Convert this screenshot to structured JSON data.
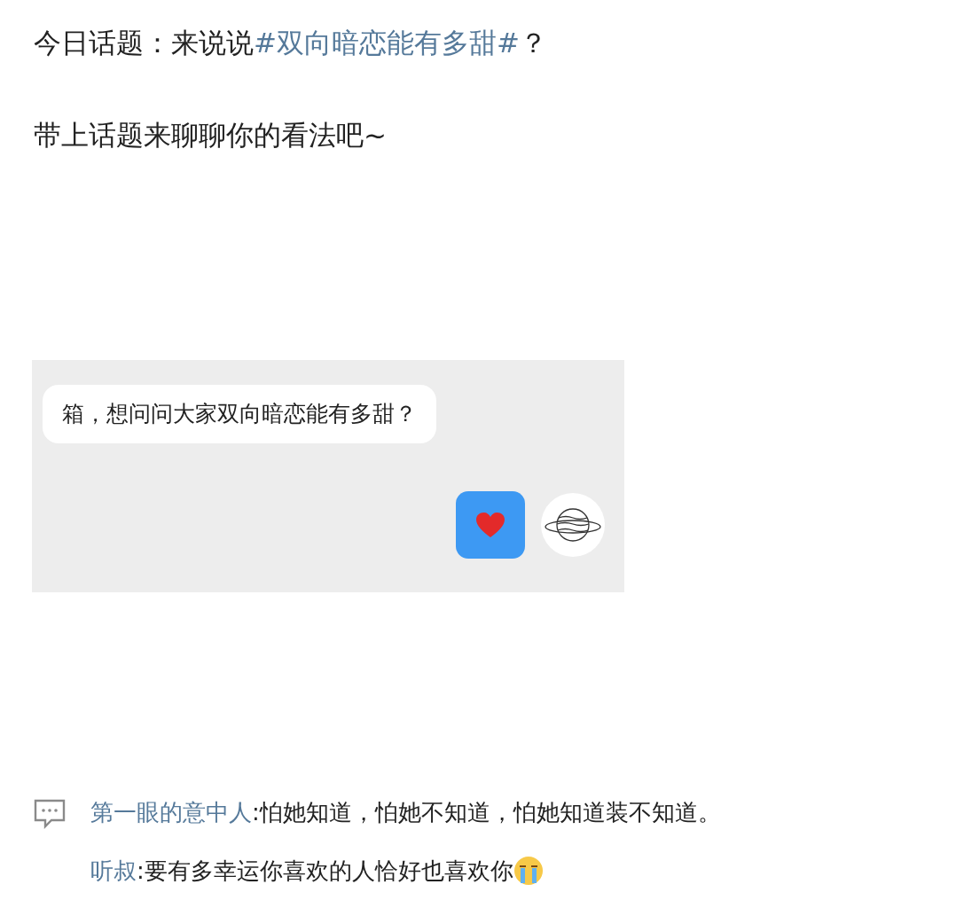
{
  "post": {
    "text_before": "今日话题：来说说",
    "hashtag": "#双向暗恋能有多甜#",
    "text_after": "？",
    "subtitle": "带上话题来聊聊你的看法吧~"
  },
  "chat_image": {
    "messages": [
      {
        "kind": "text",
        "outgoing": false,
        "text": "箱，想问问大家双向暗恋能有多甜？"
      },
      {
        "kind": "heart",
        "outgoing": true
      }
    ]
  },
  "comments": [
    {
      "user": "第一眼的意中人",
      "text": ":怕她知道，怕她不知道，怕她知道装不知道。"
    },
    {
      "user": "听叔",
      "text": ":要有多幸运你喜欢的人恰好也喜欢你",
      "emoji": {
        "kind": "crying"
      }
    }
  ]
}
